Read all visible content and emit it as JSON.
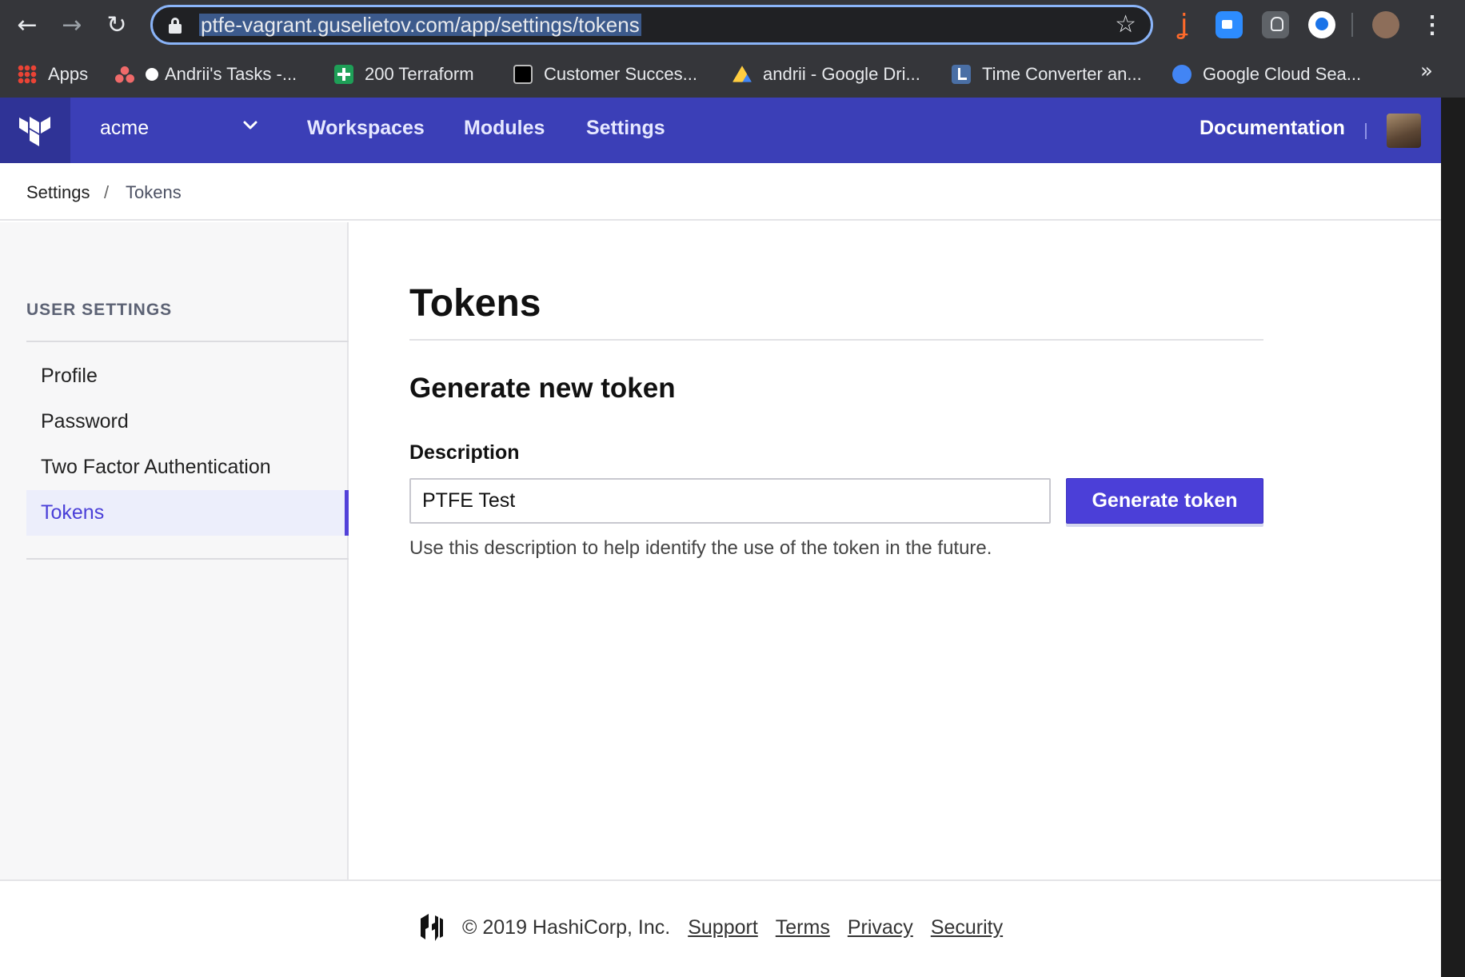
{
  "browser": {
    "url": "ptfe-vagrant.guselietov.com/app/settings/tokens",
    "bookmarks": [
      {
        "label": "Apps",
        "icon": "apps-grid-icon"
      },
      {
        "label": "Andrii's Tasks -...",
        "icon": "asana-icon"
      },
      {
        "label": "200 Terraform",
        "icon": "sheets-icon"
      },
      {
        "label": "Customer Succes...",
        "icon": "hashicorp-icon"
      },
      {
        "label": "andrii - Google Dri...",
        "icon": "google-drive-icon"
      },
      {
        "label": "Time Converter an...",
        "icon": "time-converter-icon"
      },
      {
        "label": "Google Cloud Sea...",
        "icon": "google-cloud-icon"
      }
    ],
    "bookmarks_more": "»"
  },
  "topnav": {
    "org": "acme",
    "links": [
      "Workspaces",
      "Modules",
      "Settings"
    ],
    "documentation": "Documentation",
    "accent": "#3b3fb7"
  },
  "breadcrumb": {
    "parent": "Settings",
    "separator": "/",
    "current": "Tokens"
  },
  "sidebar": {
    "heading": "USER SETTINGS",
    "items": [
      {
        "label": "Profile",
        "active": false
      },
      {
        "label": "Password",
        "active": false
      },
      {
        "label": "Two Factor Authentication",
        "active": false
      },
      {
        "label": "Tokens",
        "active": true
      }
    ]
  },
  "main": {
    "title": "Tokens",
    "section_title": "Generate new token",
    "description_label": "Description",
    "description_value": "PTFE Test",
    "generate_button": "Generate token",
    "help_text": "Use this description to help identify the use of the token in the future.",
    "button_color": "#4b3fd8"
  },
  "footer": {
    "copyright": "© 2019 HashiCorp, Inc.",
    "links": [
      "Support",
      "Terms",
      "Privacy",
      "Security"
    ]
  }
}
